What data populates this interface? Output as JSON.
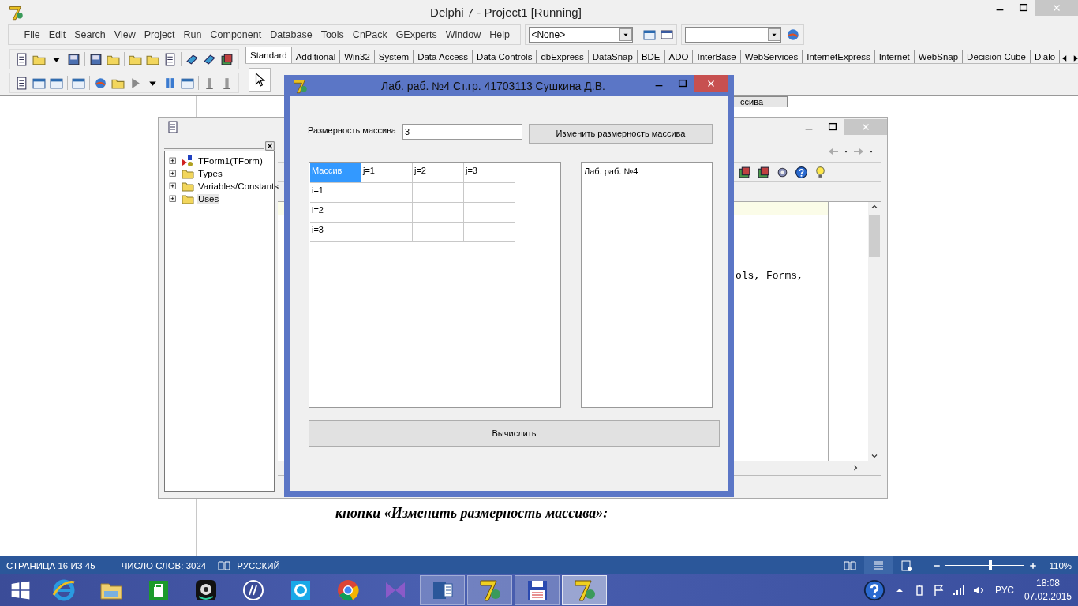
{
  "ide": {
    "title": "Delphi 7 - Project1 [Running]",
    "menu": [
      "File",
      "Edit",
      "Search",
      "View",
      "Project",
      "Run",
      "Component",
      "Database",
      "Tools",
      "CnPack",
      "GExperts",
      "Window",
      "Help"
    ],
    "configuration": "<None>",
    "palette_tabs": [
      {
        "label": "Standard",
        "selected": true
      },
      {
        "label": "Additional",
        "selected": false
      },
      {
        "label": "Win32",
        "selected": false
      },
      {
        "label": "System",
        "selected": false
      },
      {
        "label": "Data Access",
        "selected": false
      },
      {
        "label": "Data Controls",
        "selected": false
      },
      {
        "label": "dbExpress",
        "selected": false
      },
      {
        "label": "DataSnap",
        "selected": false
      },
      {
        "label": "BDE",
        "selected": false
      },
      {
        "label": "ADO",
        "selected": false
      },
      {
        "label": "InterBase",
        "selected": false
      },
      {
        "label": "WebServices",
        "selected": false
      },
      {
        "label": "InternetExpress",
        "selected": false
      },
      {
        "label": "Internet",
        "selected": false
      },
      {
        "label": "WebSnap",
        "selected": false
      },
      {
        "label": "Decision Cube",
        "selected": false
      },
      {
        "label": "Dialo",
        "selected": false
      }
    ]
  },
  "document": {
    "partial_button": "ссива",
    "caption": "кнопки «Изменить размерность массива»:"
  },
  "code_explorer": {
    "tree": [
      {
        "label": "TForm1(TForm)",
        "kind": "form",
        "selected": false
      },
      {
        "label": "Types",
        "kind": "folder",
        "selected": false
      },
      {
        "label": "Variables/Constants",
        "kind": "folder",
        "selected": false
      },
      {
        "label": "Uses",
        "kind": "folder",
        "selected": true
      }
    ],
    "code_line": "ols, Forms,"
  },
  "dialog": {
    "title": "Лаб. раб. №4 Ст.гр.  41703113 Сушкина Д.В.",
    "size_label": "Размерность массива",
    "size_value": "3",
    "resize_button": "Изменить размерность массива",
    "grid": {
      "columns": [
        {
          "label": "Массив",
          "selected": true
        },
        {
          "label": "j=1",
          "selected": false
        },
        {
          "label": "j=2",
          "selected": false
        },
        {
          "label": "j=3",
          "selected": false
        }
      ],
      "row_labels": [
        "i=1",
        "i=2",
        "i=3"
      ]
    },
    "memo_lines": [
      "Лаб. раб. №4"
    ],
    "compute_button": "Вычислить"
  },
  "word_status": {
    "page": "СТРАНИЦА 16 ИЗ 45",
    "words": "ЧИСЛО СЛОВ: 3024",
    "language": "РУССКИЙ",
    "views": [
      {
        "kind": "read",
        "selected": false
      },
      {
        "kind": "print",
        "selected": true
      },
      {
        "kind": "web",
        "selected": false
      }
    ],
    "zoom": {
      "level": 0.57,
      "reading": "110%"
    }
  },
  "taskbar": {
    "apps": [
      {
        "kind": "browser",
        "running": false,
        "selected": false
      },
      {
        "kind": "files",
        "running": false,
        "selected": false
      },
      {
        "kind": "store",
        "running": false,
        "selected": false
      },
      {
        "kind": "camera",
        "running": false,
        "selected": false
      },
      {
        "kind": "printer",
        "running": false,
        "selected": false
      },
      {
        "kind": "chat",
        "running": false,
        "selected": false
      },
      {
        "kind": "chrome",
        "running": false,
        "selected": false
      },
      {
        "kind": "studio",
        "running": false,
        "selected": false
      },
      {
        "kind": "word",
        "running": true,
        "selected": false
      },
      {
        "kind": "delphi",
        "running": true,
        "selected": false
      },
      {
        "kind": "floppy",
        "running": true,
        "selected": false
      },
      {
        "kind": "delphi",
        "running": true,
        "selected": true
      }
    ],
    "language": "РУС",
    "time": "18:08",
    "date": "07.02.2015"
  }
}
